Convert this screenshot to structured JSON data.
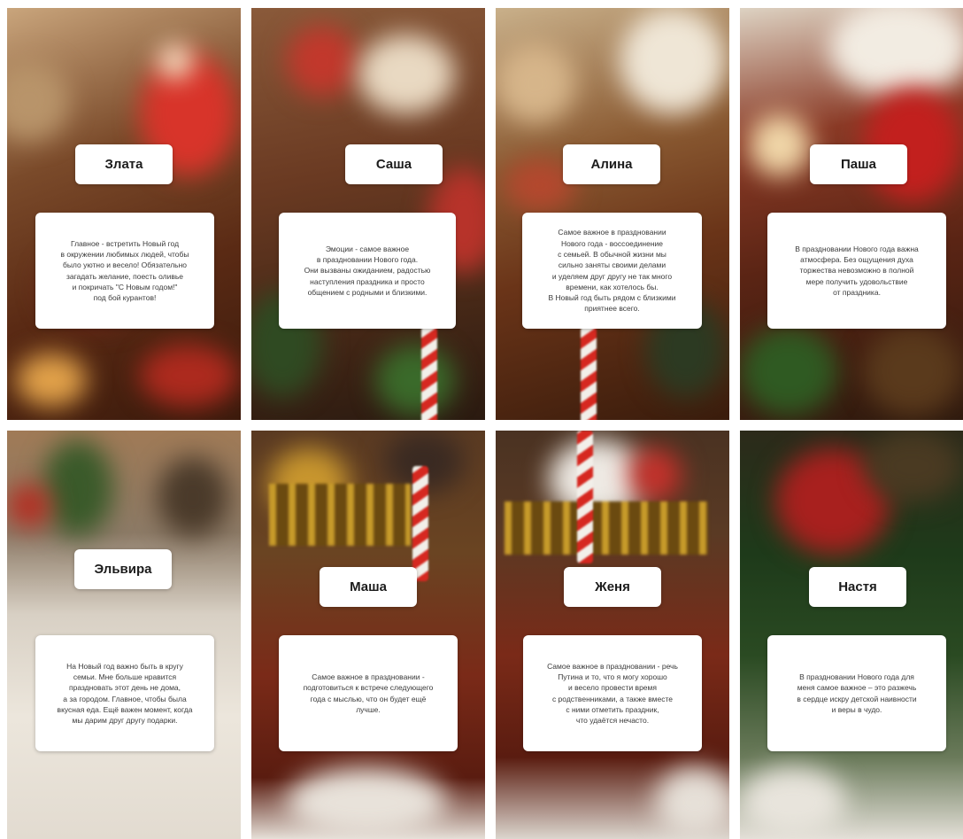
{
  "cards": [
    {
      "name": "Злата",
      "lines": [
        "Главное - встретить Новый год",
        "в окружении любимых людей, чтобы",
        "было уютно и весело! Обязательно",
        "загадать желание, поесть оливье",
        "и покричать \"С Новым годом!\"",
        "под бой курантов!"
      ]
    },
    {
      "name": "Саша",
      "lines": [
        "Эмоции - самое важное",
        "в праздновании Нового года.",
        "Они вызваны ожиданием, радостью",
        "наступления праздника и просто",
        "общением с родными и близкими."
      ]
    },
    {
      "name": "Алина",
      "lines": [
        "Самое важное в праздновании",
        "Нового года - воссоединение",
        "с семьей. В обычной жизни мы",
        "сильно заняты своими делами",
        "и уделяем друг другу не так много",
        "времени, как хотелось бы.",
        "В Новый год быть рядом с близкими",
        "приятнее всего."
      ]
    },
    {
      "name": "Паша",
      "lines": [
        "В праздновании Нового года важна",
        "атмосфера. Без ощущения духа",
        "торжества невозможно в полной",
        "мере получить удовольствие",
        "от праздника."
      ]
    },
    {
      "name": "Эльвира",
      "lines": [
        "На Новый год важно быть в кругу",
        "семьи. Мне больше нравится",
        "праздновать этот день не дома,",
        "а за городом. Главное, чтобы была",
        "вкусная еда. Ещё важен момент, когда",
        "мы дарим друг другу подарки."
      ]
    },
    {
      "name": "Маша",
      "lines": [
        "Самое важное в праздновании -",
        "подготовиться к встрече следующего",
        "года с мыслью, что он будет ещё",
        "лучше."
      ]
    },
    {
      "name": "Женя",
      "lines": [
        "Самое важное в праздновании - речь",
        "Путина и то, что я могу хорошо",
        "и весело провести время",
        "с родственниками, а также вместе",
        "с ними отметить праздник,",
        "что удаётся нечасто."
      ]
    },
    {
      "name": "Настя",
      "lines": [
        "В праздновании Нового года для",
        "меня самое важное – это разжечь",
        "в сердце искру детской наивности",
        "и веры в чудо."
      ]
    }
  ]
}
